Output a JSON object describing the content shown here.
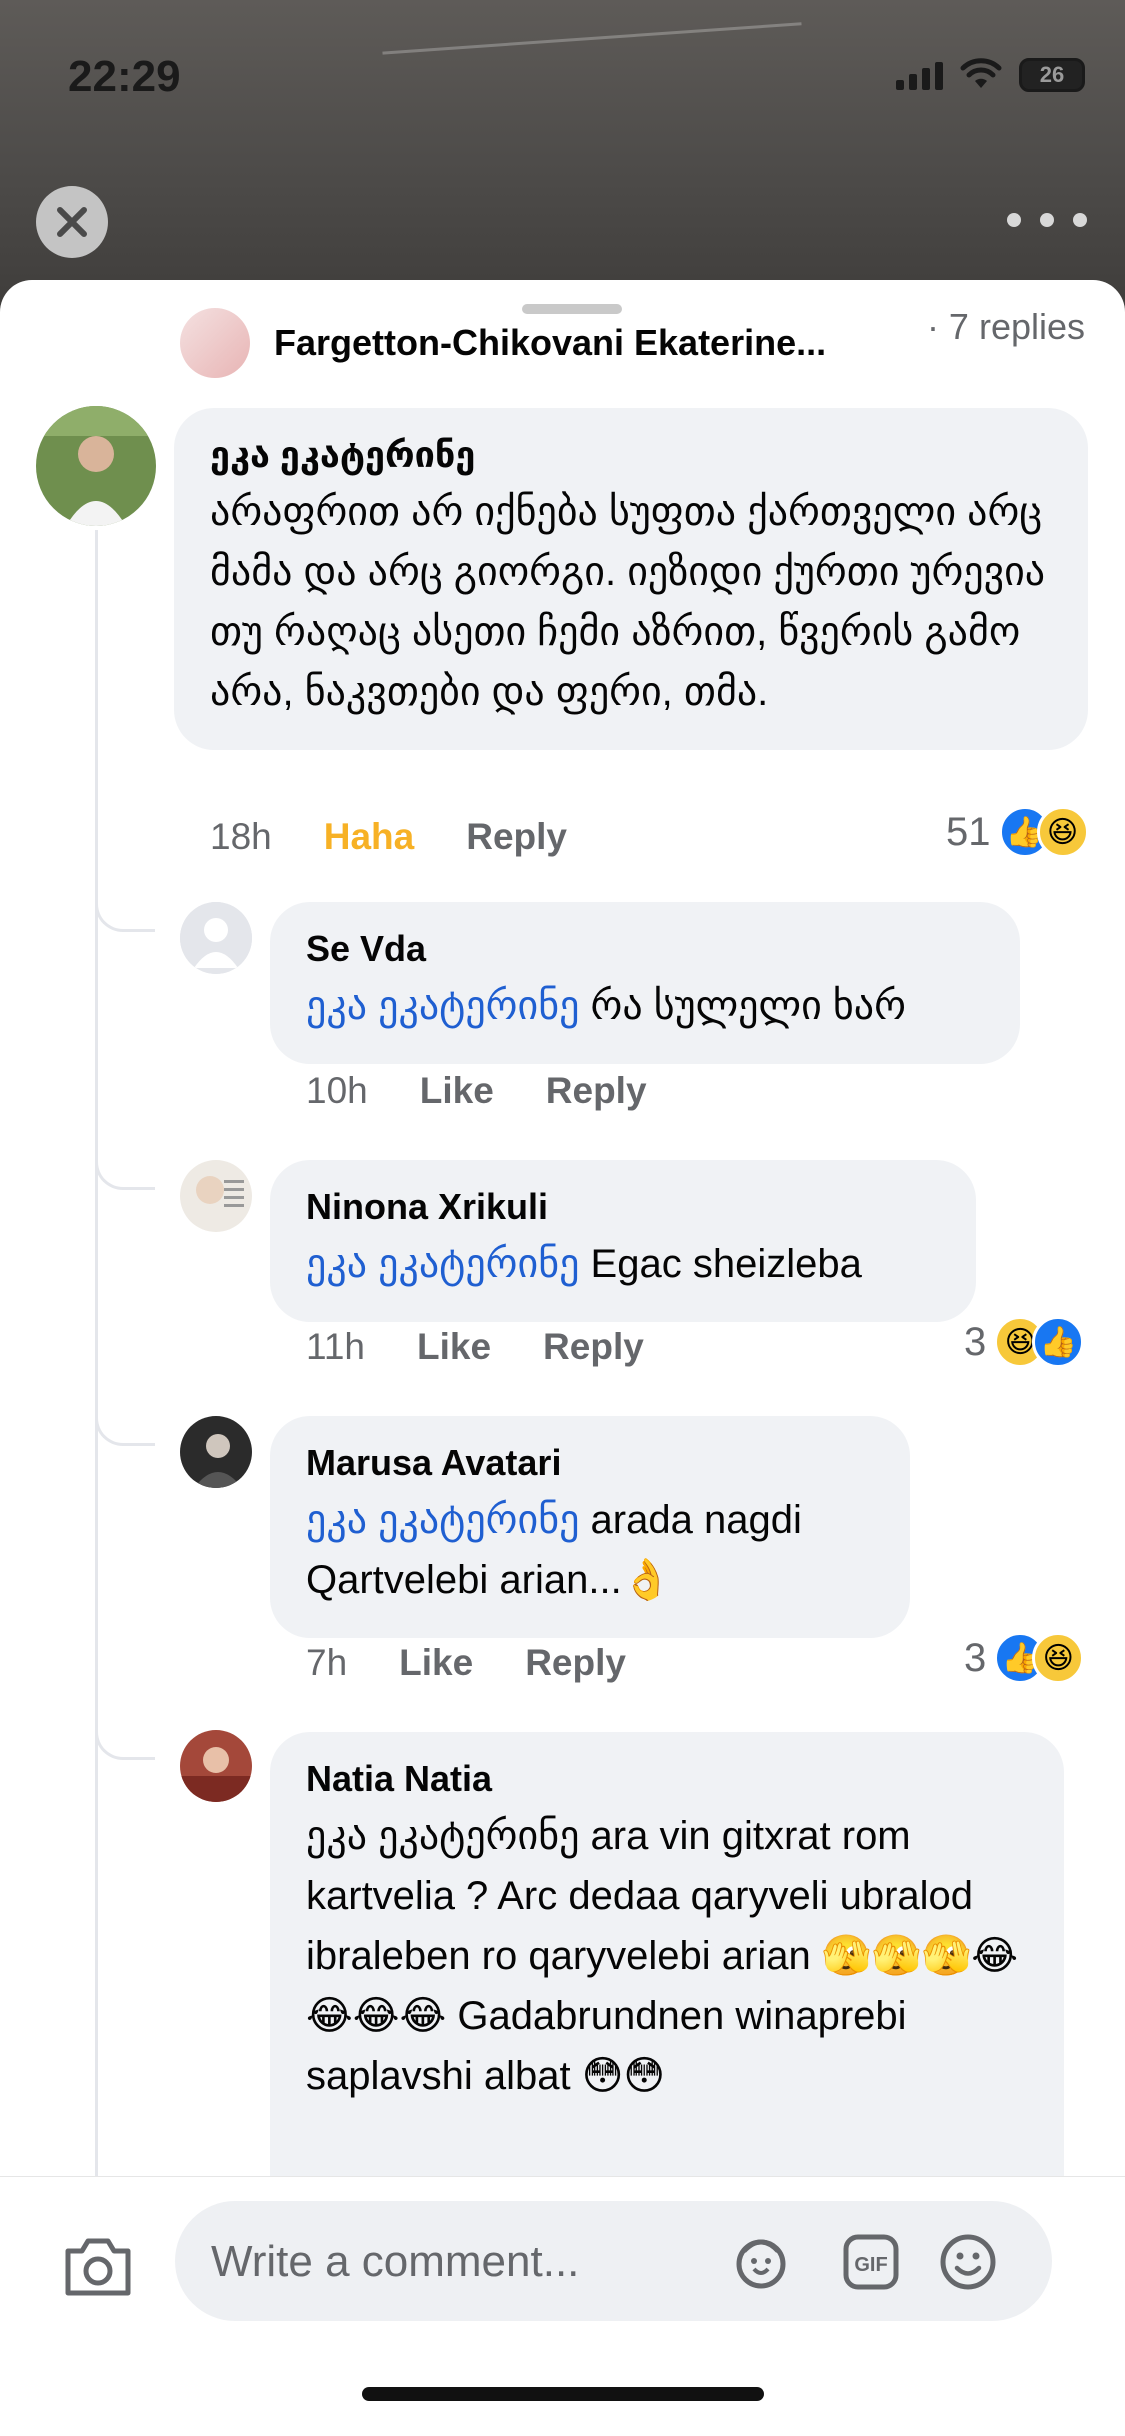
{
  "status": {
    "time": "22:29",
    "battery": "26"
  },
  "prev_reply": {
    "name": "Fargetton-Chikovani Ekaterine...",
    "replies": "· 7 replies"
  },
  "main_comment": {
    "author": "ეკა ეკატერინე",
    "text": "არაფრით არ იქნება სუფთა ქართველი არც მამა და არც გიორგი. იეზიდი ქურთი ურევია თუ რაღაც ასეთი ჩემი აზრით, წვერის გამო არა, ნაკვთები და ფერი, თმა.",
    "time": "18h",
    "reaction_label": "Haha",
    "reply_label": "Reply",
    "reaction_count": "51"
  },
  "replies": [
    {
      "author": "Se Vda",
      "mention": "ეკა ეკატერინე",
      "text": " რა სულელი ხარ",
      "time": "10h",
      "like_label": "Like",
      "reply_label": "Reply",
      "reaction_count": ""
    },
    {
      "author": "Ninona Xrikuli",
      "mention": "ეკა ეკატერინე",
      "text": " Egac sheizleba",
      "time": "11h",
      "like_label": "Like",
      "reply_label": "Reply",
      "reaction_count": "3"
    },
    {
      "author": "Marusa Avatari",
      "mention": "ეკა ეკატერინე",
      "text": " arada nagdi Qartvelebi arian...👌",
      "time": "7h",
      "like_label": "Like",
      "reply_label": "Reply",
      "reaction_count": "3"
    },
    {
      "author": "Natia Natia",
      "mention": "",
      "text": "ეკა ეკატერინე ara vin gitxrat rom kartvelia ? Arc dedaa qaryveli ubralod ibraleben  ro qaryvelebi arian 🫣🫣🫣😂😂😂😂 Gadabrundnen winaprebi saplavshi albat 😳😳"
    }
  ],
  "composer": {
    "placeholder": "Write a comment..."
  },
  "colors": {
    "mention": "#1f5fd1",
    "haha": "#f7b125",
    "like_blue": "#1877f2",
    "bubble_bg": "#f0f2f5"
  },
  "icons": [
    "close-icon",
    "more-icon",
    "camera-icon",
    "avatar-sticker-icon",
    "gif-icon",
    "emoji-icon",
    "like-reaction-icon",
    "haha-reaction-icon"
  ]
}
